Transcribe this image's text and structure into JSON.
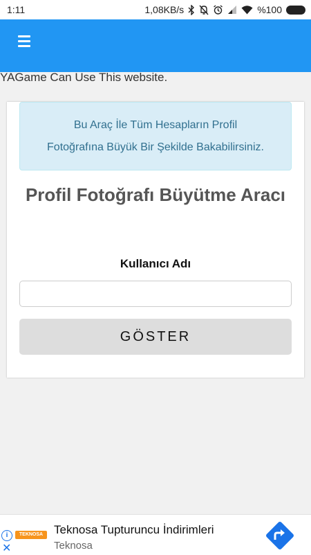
{
  "status_bar": {
    "time": "1:11",
    "network_speed": "1,08KB/s",
    "battery": "%100",
    "icons": [
      "bluetooth-icon",
      "bell-off-icon",
      "alarm-icon",
      "signal-icon",
      "wifi-icon",
      "battery-icon"
    ]
  },
  "app_bar": {
    "color": "#2196f3",
    "menu_icon": "hamburger-menu-icon"
  },
  "page": {
    "info_text": "YAGame Can Use This website."
  },
  "card": {
    "alert_line1": "Bu Araç İle Tüm Hesapların Profil",
    "alert_line2": "Fotoğrafına Büyük Bir Şekilde Bakabilirsiniz.",
    "title": "Profil Fotoğrafı Büyütme Aracı",
    "username_label": "Kullanıcı Adı",
    "username_value": "",
    "submit_label": "GÖSTER"
  },
  "ad": {
    "title": "Teknosa Tupturuncu İndirimleri",
    "subtitle": "Teknosa",
    "logo_text": "TEKNOSA",
    "action_icon": "directions-arrow-icon",
    "accent": "#1a73e8"
  }
}
